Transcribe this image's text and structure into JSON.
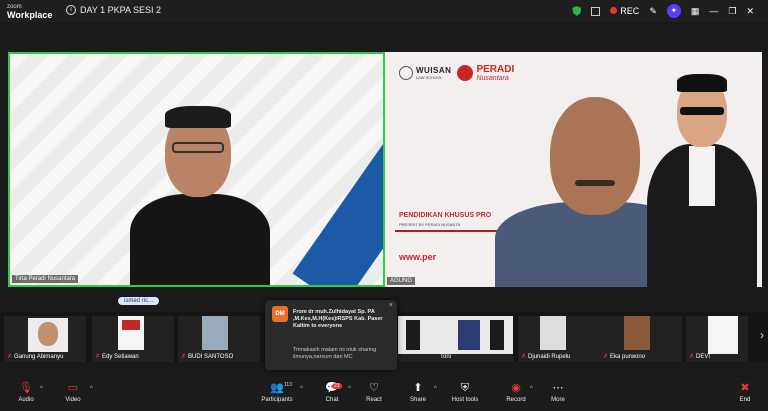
{
  "titlebar": {
    "logo_line1": "zoom",
    "logo_line2": "Workplace",
    "meeting_title": "DAY 1 PKPA SESI 2",
    "rec_label": "REC"
  },
  "tile1": {
    "name": "Tirta Peradi Nusantara",
    "emoji": "👏"
  },
  "tile2": {
    "name": "AGUNG",
    "logo_text": "WUISAN",
    "logo_sub": "LAW SCHOOL",
    "peradi": "PERADI",
    "peradi_sub": "Nusantara",
    "headline": "PENDIDIKAN KHUSUS PRO",
    "subline": "PRESENT BY PERADI NUSANTA",
    "www": "www.per"
  },
  "speaking_pill": "ismed ric...",
  "thumbnails": [
    {
      "name": "Ganung Abimanyu"
    },
    {
      "name": "Edy Setiawan"
    },
    {
      "name": "BUDI SANTOSO"
    },
    {
      "name": "Toni"
    },
    {
      "name": "Djunaidi Rupelu"
    },
    {
      "name": "Eka purwono"
    },
    {
      "name": "DEVI"
    }
  ],
  "chat": {
    "avatar": "DM",
    "from": "From dr muh.Zulhidayat Sp. PA ,M.Kes,M.H(Kes)iRSPS Kab. Paser Kaltim to everyone",
    "message": "Trimakasih malam ini ntuk sharing ilmunya,narsum dan MC",
    "close": "×"
  },
  "toolbar": {
    "audio": "Audio",
    "video": "Video",
    "participants": "Participants",
    "participants_count": "113",
    "chat": "Chat",
    "chat_badge": "23",
    "react": "React",
    "share": "Share",
    "host_tools": "Host tools",
    "record": "Record",
    "more": "More",
    "end": "End"
  },
  "colors": {
    "active_speaker": "#2ecc40",
    "accent_red": "#c62828",
    "end": "#e53935"
  }
}
